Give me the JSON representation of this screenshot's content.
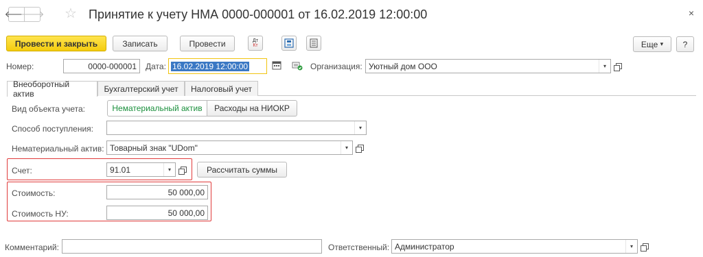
{
  "window": {
    "title": "Принятие к учету НМА 0000-000001 от 16.02.2019 12:00:00",
    "close": "×",
    "back": "🡐",
    "forward": "🡒",
    "star": "☆"
  },
  "toolbar": {
    "post_close": "Провести и закрыть",
    "save": "Записать",
    "post": "Провести",
    "dt_kt_top": "Дт",
    "dt_kt_bottom": "Кт",
    "more": "Еще",
    "more_arrow": "▾",
    "help": "?"
  },
  "header": {
    "number_label": "Номер:",
    "number_value": "0000-000001",
    "date_label": "Дата:",
    "date_value": "16.02.2019 12:00:00",
    "org_label": "Организация:",
    "org_value": "Уютный дом ООО"
  },
  "tabs": [
    {
      "label": "Внеоборотный актив",
      "active": true
    },
    {
      "label": "Бухгалтерский учет",
      "active": false
    },
    {
      "label": "Налоговый учет",
      "active": false
    }
  ],
  "form": {
    "object_type_label": "Вид объекта учета:",
    "object_type_options": [
      "Нематериальный актив",
      "Расходы на НИОКР"
    ],
    "receipt_method_label": "Способ поступления:",
    "receipt_method_value": "",
    "intangible_label": "Нематериальный актив:",
    "intangible_value": "Товарный знак \"UDom\"",
    "account_label": "Счет:",
    "account_value": "91.01",
    "calc_button": "Рассчитать суммы",
    "cost_label": "Стоимость:",
    "cost_value": "50 000,00",
    "cost_tax_label": "Стоимость НУ:",
    "cost_tax_value": "50 000,00"
  },
  "footer": {
    "comment_label": "Комментарий:",
    "comment_value": "",
    "responsible_label": "Ответственный:",
    "responsible_value": "Администратор"
  },
  "icons": {
    "dropdown": "▾",
    "calendar": "calendar-icon",
    "highlight_color": "#e03a3a",
    "accent_color": "#f4cc0e",
    "selected_text_color": "#1a8f3c"
  }
}
